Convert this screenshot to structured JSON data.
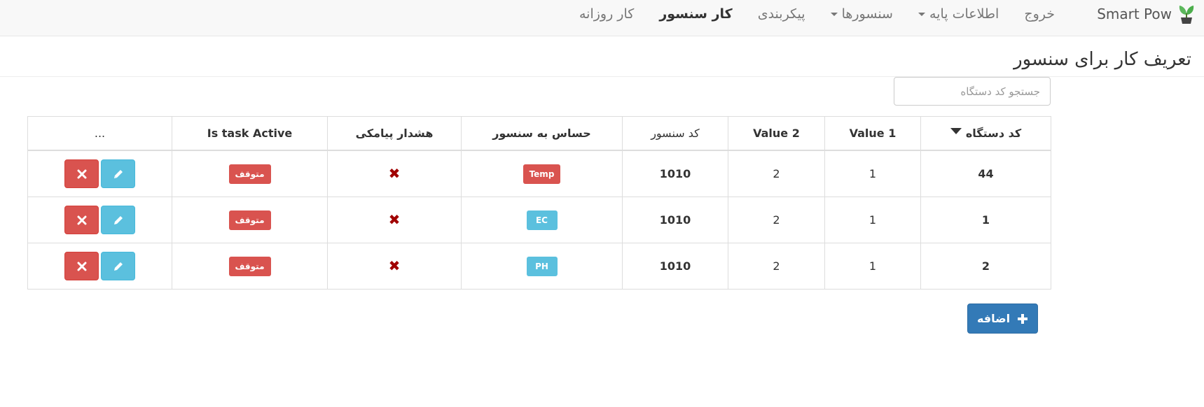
{
  "app": {
    "brand": "Smart Pow"
  },
  "nav": {
    "items": [
      {
        "label": "کار روزانه",
        "active": false,
        "dropdown": false
      },
      {
        "label": "کار سنسور",
        "active": true,
        "dropdown": false
      },
      {
        "label": "پیکربندی",
        "active": false,
        "dropdown": false
      },
      {
        "label": "سنسورها",
        "active": false,
        "dropdown": true
      },
      {
        "label": "اطلاعات پایه",
        "active": false,
        "dropdown": true
      },
      {
        "label": "خروج",
        "active": false,
        "dropdown": false
      }
    ]
  },
  "page": {
    "title": "تعریف کار برای سنسور"
  },
  "search": {
    "placeholder": "جستجو کد دستگاه",
    "value": ""
  },
  "table": {
    "headers": [
      "کد دستگاه",
      "Value 1",
      "Value 2",
      "کد سنسور",
      "حساس به سنسور",
      "هشدار پیامکی",
      "Is task Active",
      "..."
    ],
    "rows": [
      {
        "device": "44",
        "v1": "1",
        "v2": "2",
        "sensor_code": "1010",
        "sensor": "Temp",
        "sms": "✖",
        "status": "متوقف"
      },
      {
        "device": "1",
        "v1": "1",
        "v2": "2",
        "sensor_code": "1010",
        "sensor": "EC",
        "sms": "✖",
        "status": "متوقف"
      },
      {
        "device": "2",
        "v1": "1",
        "v2": "2",
        "sensor_code": "1010",
        "sensor": "PH",
        "sms": "✖",
        "status": "متوقف"
      }
    ]
  },
  "actions": {
    "add_label": "اضافه"
  },
  "colors": {
    "primary": "#337ab7",
    "danger": "#d9534f",
    "info": "#5bc0de",
    "x_mark": "#a00000"
  }
}
